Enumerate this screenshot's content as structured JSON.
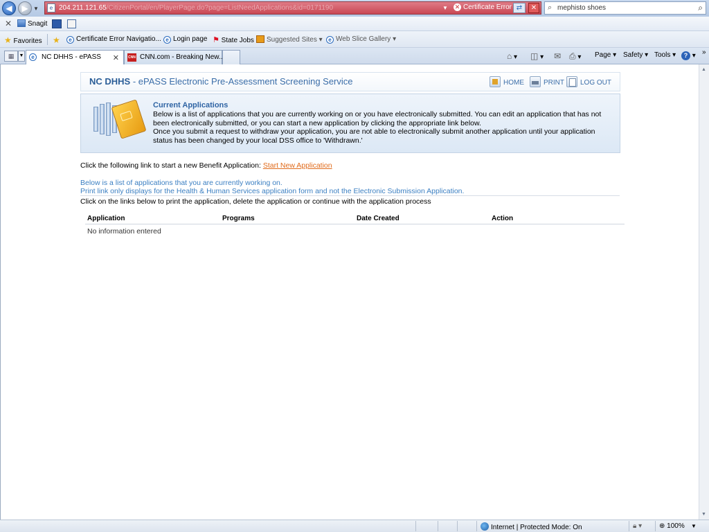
{
  "browser": {
    "address": {
      "host": "204.211.121.65",
      "path_blurred": "/CitizenPortal/en/PlayerPage.do?page=ListNeedApplications&id=0171190",
      "cert_error": "Certificate Error"
    },
    "search": {
      "value": "mephisto shoes"
    },
    "command_bar": {
      "snagit_label": "Snagit"
    },
    "favorites_bar": {
      "favorites_label": "Favorites",
      "items": [
        {
          "label": "Certificate Error Navigatio..."
        },
        {
          "label": "Login page"
        },
        {
          "label": "State Jobs"
        },
        {
          "label": "Suggested Sites ▾"
        },
        {
          "label": "Web Slice Gallery ▾"
        }
      ]
    },
    "tabs": [
      {
        "label": "NC DHHS - ePASS",
        "active": true
      },
      {
        "label": "CNN.com - Breaking New...",
        "active": false
      }
    ],
    "toolbar": {
      "page": "Page",
      "safety": "Safety",
      "tools": "Tools"
    },
    "status": {
      "zone": "Internet | Protected Mode: On",
      "zoom": "100%"
    }
  },
  "page": {
    "header": {
      "brand": "NC DHHS",
      "title": " - ePASS Electronic Pre-Assessment Screening Service",
      "nav": {
        "home": "HOME",
        "print": "PRINT",
        "logout": "LOG OUT"
      }
    },
    "info": {
      "title": "Current Applications",
      "text1": "Below is a list of applications that you are currently working on or you have electronically submitted. You can edit an application that has not been electronically submitted, or you can start a new application by clicking the appropriate link below.",
      "text2": "Once you submit a request to withdraw your application, you are not able to electronically submit another application until your application status has been changed by your local DSS office to 'Withdrawn.'"
    },
    "start_prompt": "Click the following link to start a new Benefit Application:",
    "start_link": "Start New Application",
    "note1": "Below is a list of applications that you are currently working on.",
    "note2": "Print link only displays for the Health & Human Services application form and not the Electronic Submission Application.",
    "instructions": "Click on the links below to print the application, delete the application or continue with the application process",
    "table": {
      "headers": [
        "Application",
        "Programs",
        "Date Created",
        "Action"
      ],
      "empty_text": "No information entered"
    }
  }
}
